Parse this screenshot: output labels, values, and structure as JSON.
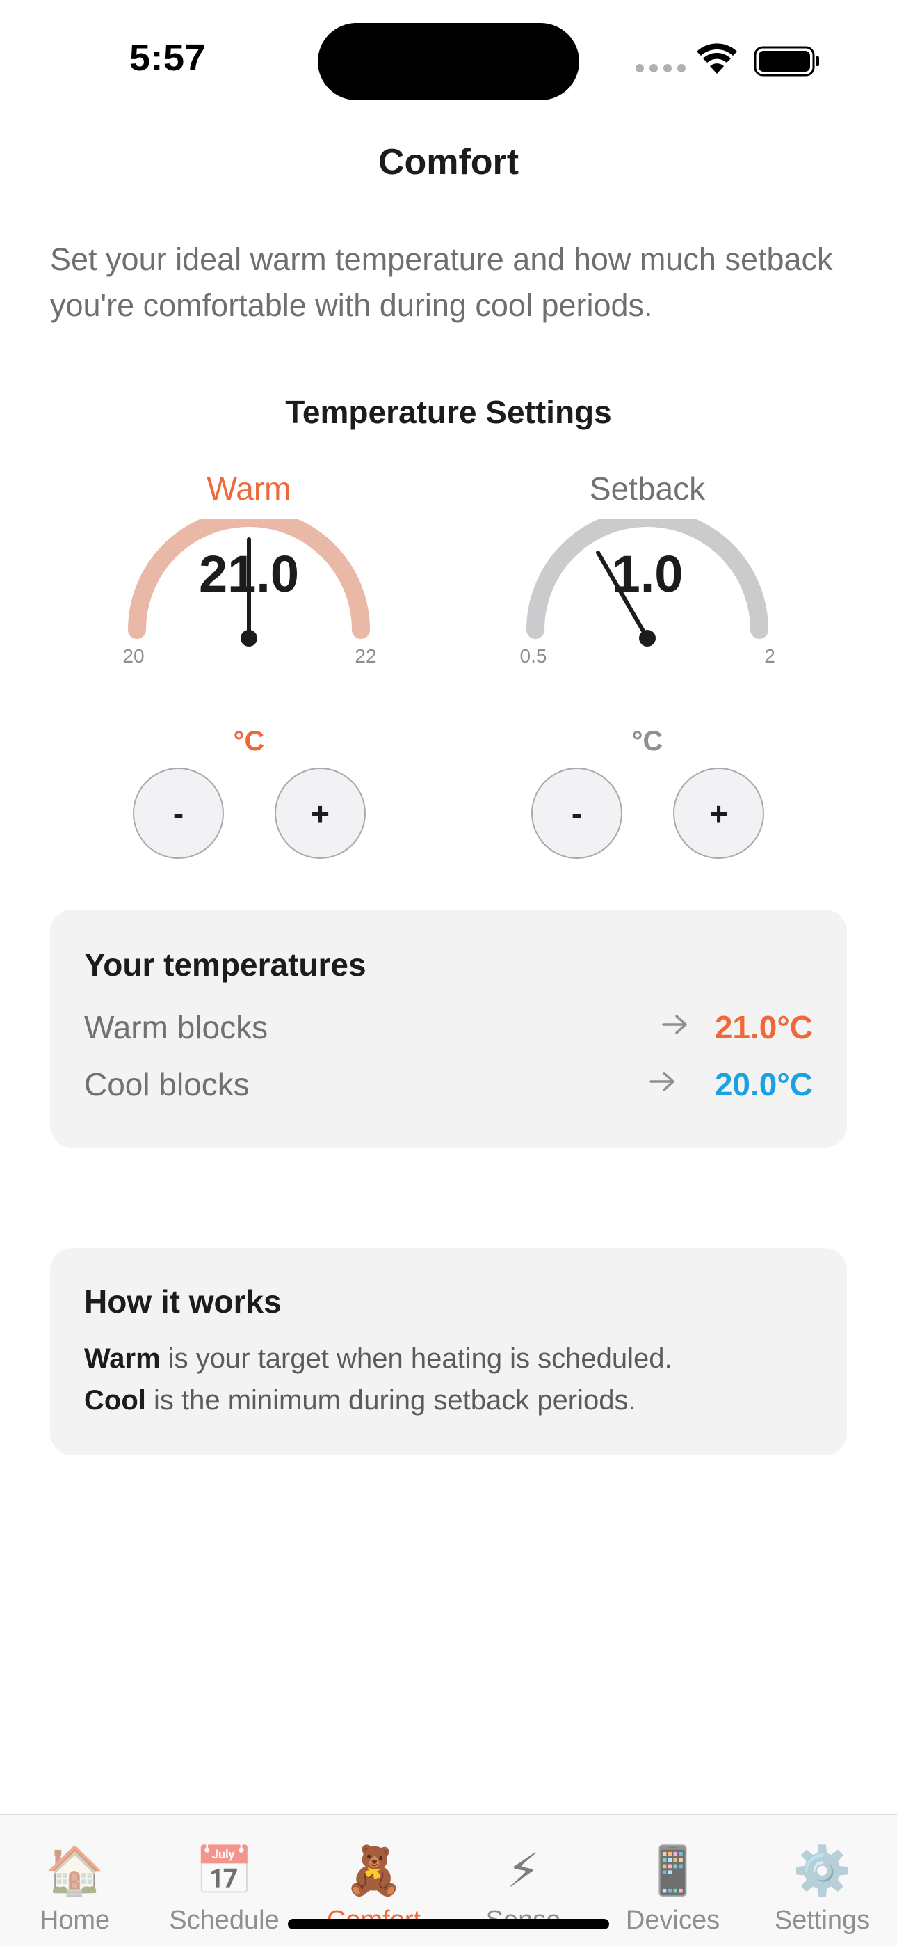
{
  "status_bar": {
    "time": "5:57"
  },
  "page": {
    "title": "Comfort",
    "intro": "Set your ideal warm temperature and how much setback you're comfortable with during cool periods."
  },
  "temperature_settings": {
    "title": "Temperature Settings",
    "warm": {
      "label": "Warm",
      "value": "21.0",
      "min_label": "20",
      "max_label": "22",
      "min": 20,
      "max": 22,
      "current": 21.0,
      "unit": "°C",
      "color": "#f0683a",
      "arc_color": "#eab8a6",
      "minus": "-",
      "plus": "+"
    },
    "setback": {
      "label": "Setback",
      "value": "1.0",
      "min_label": "0.5",
      "max_label": "2",
      "min": 0.5,
      "max": 2,
      "current": 1.0,
      "unit": "°C",
      "color": "#707075",
      "arc_color": "#cbcbcd",
      "minus": "-",
      "plus": "+"
    }
  },
  "your_temperatures": {
    "title": "Your temperatures",
    "rows": [
      {
        "label": "Warm blocks",
        "value": "21.0°C",
        "color": "#f0683a"
      },
      {
        "label": "Cool blocks",
        "value": "20.0°C",
        "color": "#1ba1e2"
      }
    ]
  },
  "how_it_works": {
    "title": "How it works",
    "line1_bold": "Warm",
    "line1_rest": " is your target when heating is scheduled.",
    "line2_bold": "Cool",
    "line2_rest": " is the minimum during setback periods."
  },
  "tab_bar": {
    "active": "Comfort",
    "active_color": "#f0683a",
    "tabs": [
      {
        "label": "Home",
        "icon": "house-icon",
        "glyph": "🏠"
      },
      {
        "label": "Schedule",
        "icon": "calendar-icon",
        "glyph": "📅"
      },
      {
        "label": "Comfort",
        "icon": "teddy-bear-icon",
        "glyph": "🧸"
      },
      {
        "label": "Sense",
        "icon": "lightning-icon",
        "glyph": "⚡"
      },
      {
        "label": "Devices",
        "icon": "phone-icon",
        "glyph": "📱"
      },
      {
        "label": "Settings",
        "icon": "gear-icon",
        "glyph": "⚙️"
      }
    ]
  }
}
